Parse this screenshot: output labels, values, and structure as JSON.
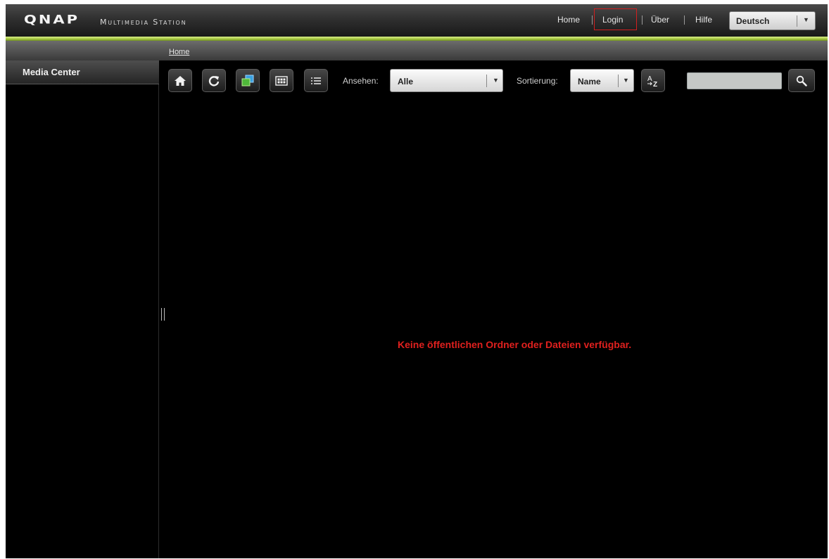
{
  "header": {
    "logo_text": "QNAP",
    "app_name": "Multimedia Station",
    "nav": {
      "home": "Home",
      "login": "Login",
      "about": "Über",
      "help": "Hilfe"
    },
    "language": {
      "selected": "Deutsch"
    }
  },
  "breadcrumb": {
    "current": "Home"
  },
  "sidebar": {
    "title": "Media Center"
  },
  "toolbar": {
    "home_icon": "home-icon",
    "refresh_icon": "refresh-icon",
    "slideshow_icon": "slideshow-icon",
    "thumbnail_icon": "thumbnail-view-icon",
    "list_icon": "list-view-icon",
    "view_label": "Ansehen:",
    "view_selected": "Alle",
    "sort_label": "Sortierung:",
    "sort_selected": "Name",
    "sort_order_icon": "sort-az-icon",
    "search_value": "",
    "search_icon": "search-icon"
  },
  "content": {
    "empty_message": "Keine öffentlichen Ordner oder Dateien verfügbar."
  },
  "colors": {
    "accent_green": "#a2c43e",
    "message_red": "#e0201e",
    "highlight_box": "#d21f1f",
    "background": "#000000"
  }
}
